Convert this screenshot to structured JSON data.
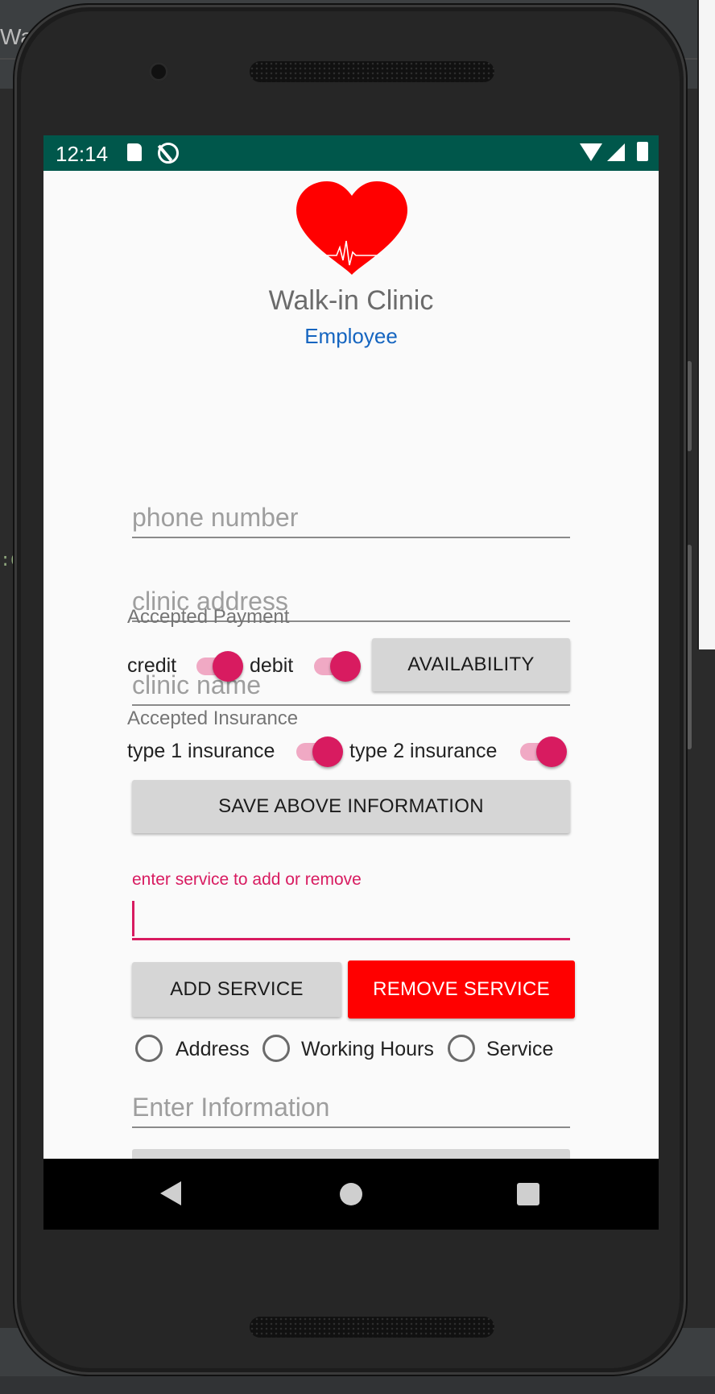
{
  "ide": {
    "tab_title": "Wa",
    "code_mark": ":C"
  },
  "status_bar": {
    "time": "12:14",
    "icons": [
      "sd-card-icon",
      "sync-disabled-icon",
      "wifi-icon",
      "signal-icon",
      "battery-icon"
    ],
    "color": "#00574b"
  },
  "header": {
    "logo_icon": "heart-pulse-icon",
    "title": "Walk-in Clinic",
    "subtitle": "Employee"
  },
  "form": {
    "phone_placeholder": "phone number",
    "address_placeholder": "clinic address",
    "name_placeholder": "clinic name",
    "payment_heading": "Accepted Payment",
    "credit_label": "credit",
    "credit_on": true,
    "debit_label": "debit",
    "debit_on": true,
    "availability_button": "AVAILABILITY",
    "insurance_heading": "Accepted Insurance",
    "insurance1_label": "type 1 insurance",
    "insurance1_on": true,
    "insurance2_label": "type 2 insurance",
    "insurance2_on": true,
    "save_button": "SAVE ABOVE INFORMATION"
  },
  "service": {
    "hint": "enter service to add or remove",
    "value": "",
    "add_button": "ADD SERVICE",
    "remove_button": "REMOVE SERVICE"
  },
  "options": {
    "radios": [
      {
        "label": "Address",
        "checked": false
      },
      {
        "label": "Working Hours",
        "checked": false
      },
      {
        "label": "Service",
        "checked": false
      }
    ],
    "info_placeholder": "Enter Information"
  },
  "nav_bar": {
    "icons": [
      "back-icon",
      "home-icon",
      "recents-icon"
    ]
  },
  "colors": {
    "accent": "#d81b60",
    "remove_button": "#ff0000",
    "subtitle": "#1565c0"
  }
}
